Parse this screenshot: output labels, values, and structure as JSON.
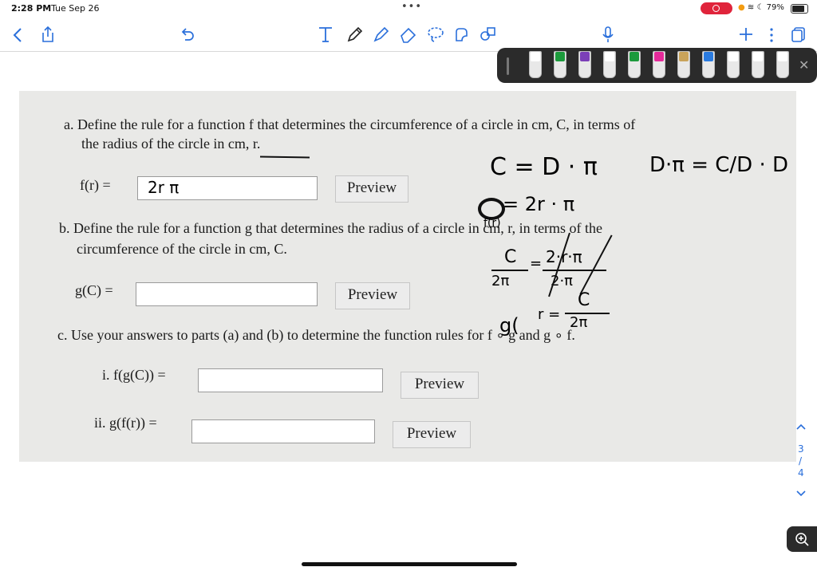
{
  "status": {
    "time": "2:28 PM",
    "date": "Tue Sep 26",
    "battery": "79%"
  },
  "toolbar": {
    "icons": [
      "back-icon",
      "share-icon",
      "undo-icon",
      "text-tool-icon",
      "pen-icon",
      "highlighter-icon",
      "eraser-icon",
      "lasso-icon",
      "shapes-icon",
      "sticker-icon",
      "microphone-icon",
      "add-page-icon",
      "more-icon",
      "pages-icon"
    ]
  },
  "palette": {
    "colors": [
      "#ffffff",
      "#1c9a3c",
      "#7b3fb8",
      "#ffffff",
      "#1c9a3c",
      "#e52a9a",
      "#c9a35a",
      "#2a7be0",
      "#ffffff",
      "#ffffff",
      "#ffffff"
    ]
  },
  "problem": {
    "a": {
      "text_line1": "a. Define the rule for a function f that determines the circumference of a circle in cm, C, in terms of",
      "text_line2": "the radius of the circle in cm, r.",
      "label": "f(r) =",
      "value": "2r π",
      "button": "Preview"
    },
    "b": {
      "text_line1": "b. Define the rule for a function g that determines the radius of a circle in cm, r, in terms of the",
      "text_line2": "circumference of the circle in cm, C.",
      "label": "g(C) =",
      "value": "",
      "button": "Preview"
    },
    "c": {
      "text": "c. Use your answers to parts (a) and (b) to determine the function rules for f ∘ g and g ∘ f.",
      "i_label": "i. f(g(C)) =",
      "i_button": "Preview",
      "ii_label": "ii. g(f(r)) =",
      "ii_button": "Preview"
    }
  },
  "handwriting": {
    "eq1": "C = D · π",
    "eq2": "D·π = C/D · D",
    "eq3": "= 2r · π",
    "eq3_sub": "f(r)",
    "eq4_left_num": "C",
    "eq4_left_den": "2π",
    "eq4_right_num": "2·r·π",
    "eq4_right_den": "2·π",
    "eq5_prefix": "g(",
    "eq5_r": "r =",
    "eq5_num": "C",
    "eq5_den": "2π"
  },
  "pager": {
    "current": "3",
    "total": "4",
    "separator": "/"
  }
}
